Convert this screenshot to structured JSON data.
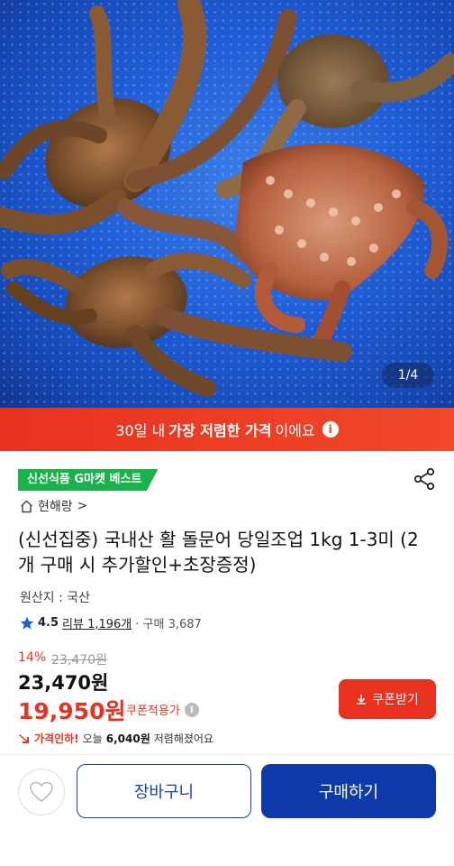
{
  "hero": {
    "counter": "1/4"
  },
  "banner": {
    "text_prefix": "30일 내 ",
    "text_bold": "가장 저렴한 가격",
    "text_suffix": "이에요",
    "info_glyph": "i"
  },
  "product": {
    "badge": "신선식품 G마켓 베스트",
    "store": "현해랑",
    "store_chevron": ">",
    "title": "(신선집중) 국내산 활 돌문어 당일조업 1kg 1-3미 (2개 구매 시 추가할인+초장증정)",
    "origin": "원산지 : 국산",
    "rating": "4.5",
    "reviews": "리뷰 1,196개",
    "sales": "· 구매 3,687"
  },
  "pricing": {
    "discount_rate": "14%",
    "original_price": "23,470원",
    "price": "23,470원",
    "coupon_price": "19,950원",
    "coupon_note": "쿠폰적용가",
    "drop_label": "가격인하!",
    "drop_text_prefix": "오늘",
    "drop_amount": "6,040원",
    "drop_text_suffix": "저렴해졌어요",
    "coupon_button": "쿠폰받기"
  },
  "actions": {
    "cart": "장바구니",
    "buy": "구매하기"
  },
  "colors": {
    "accent_red": "#e8321f",
    "badge_green": "#19b24b",
    "primary_blue": "#0d3aa8"
  }
}
